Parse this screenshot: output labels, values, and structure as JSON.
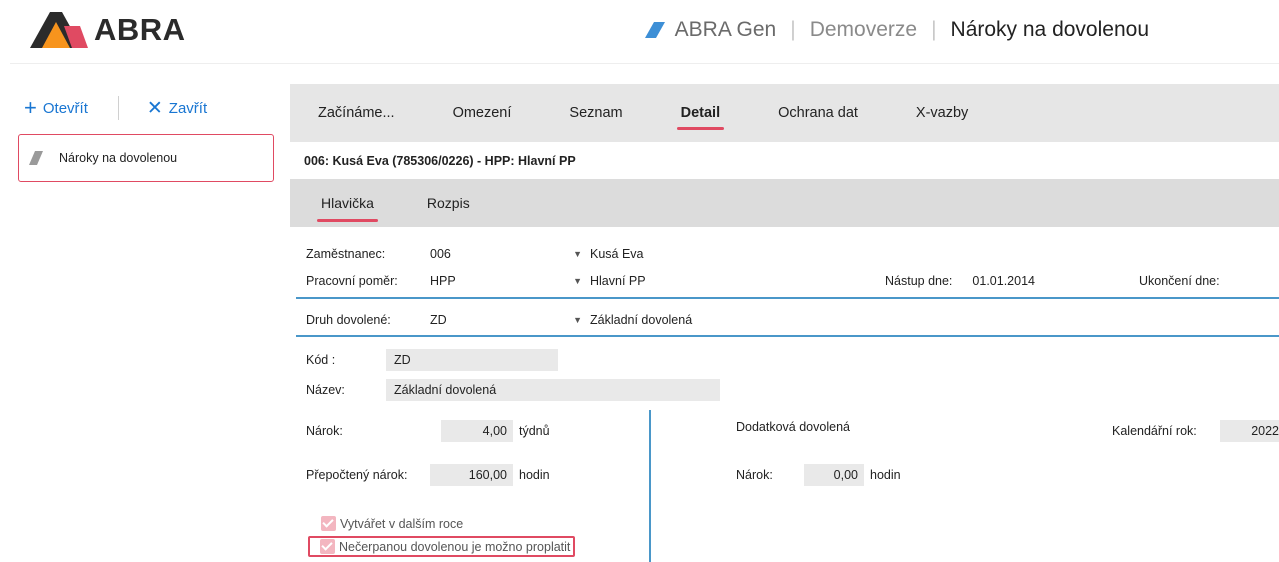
{
  "header": {
    "logo_text": "ABRA",
    "app_name": "ABRA Gen",
    "separator": "|",
    "environment": "Demoverze",
    "page_title": "Nároky na dovolenou"
  },
  "sidebar": {
    "open_label": "Otevřít",
    "close_label": "Zavřít",
    "items": [
      {
        "label": "Nároky na dovolenou"
      }
    ]
  },
  "tabs_main": [
    {
      "label": "Začínáme..."
    },
    {
      "label": "Omezení"
    },
    {
      "label": "Seznam"
    },
    {
      "label": "Detail",
      "active": true
    },
    {
      "label": "Ochrana dat"
    },
    {
      "label": "X-vazby"
    }
  ],
  "record_title": "006: Kusá Eva (785306/0226) - HPP: Hlavní PP",
  "tabs_sub": [
    {
      "label": "Hlavička",
      "active": true
    },
    {
      "label": "Rozpis"
    }
  ],
  "form": {
    "employee_label": "Zaměstnanec:",
    "employee_value": "006",
    "employee_name": "Kusá Eva",
    "employment_label": "Pracovní poměr:",
    "employment_value": "HPP",
    "employment_desc": "Hlavní PP",
    "start_label": "Nástup dne:",
    "start_value": "01.01.2014",
    "end_label": "Ukončení dne:",
    "end_value": "",
    "leave_type_label": "Druh dovolené:",
    "leave_type_value": "ZD",
    "leave_type_desc": "Základní dovolená",
    "code_label": "Kód :",
    "code_value": "ZD",
    "name_label": "Název:",
    "name_value": "Základní dovolená",
    "entitlement_label": "Nárok:",
    "entitlement_value": "4,00",
    "entitlement_unit": "týdnů",
    "recalc_label": "Přepočtený nárok:",
    "recalc_value": "160,00",
    "recalc_unit": "hodin",
    "carry_label": "Vytvářet v dalším roce",
    "payout_label": "Nečerpanou dovolenou je možno proplatit",
    "extra_leave_label": "Dodatková dovolená",
    "extra_entitlement_label": "Nárok:",
    "extra_entitlement_value": "0,00",
    "extra_entitlement_unit": "hodin",
    "year_label": "Kalendářní rok:",
    "year_value": "2022"
  },
  "colors": {
    "accent": "#e04a62",
    "link_blue": "#1976d2",
    "separator_blue": "#4a97c9",
    "tab_bg": "#e6e6e6"
  }
}
